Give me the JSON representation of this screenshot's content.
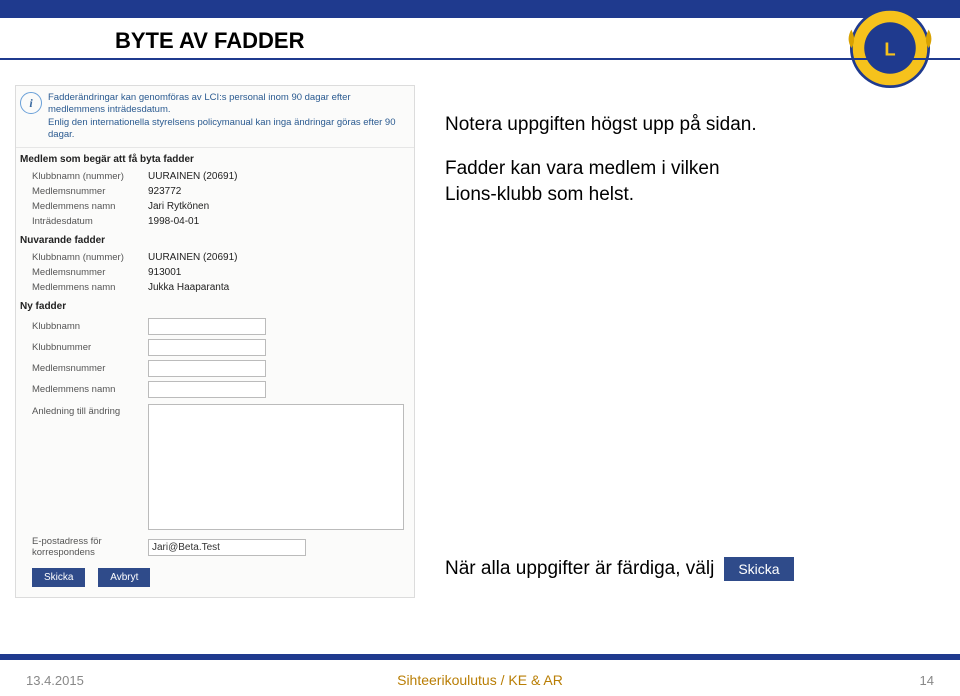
{
  "title": "BYTE AV FADDER",
  "info": {
    "line1": "Fadderändringar kan genomföras av LCI:s personal inom 90 dagar efter medlemmens inträdesdatum.",
    "line2": "Enlig den internationella styrelsens policymanual kan inga ändringar göras efter 90 dagar."
  },
  "sections": {
    "member": "Medlem som begär att få byta fadder",
    "current": "Nuvarande fadder",
    "new": "Ny fadder"
  },
  "labels": {
    "clubname": "Klubbnamn (nummer)",
    "clubname_short": "Klubbnamn",
    "clubnum": "Klubbnummer",
    "memnum": "Medlemsnummer",
    "memname": "Medlemmens namn",
    "joindate": "Inträdesdatum",
    "reason": "Anledning till ändring",
    "email": "E-postadress för korrespondens"
  },
  "member": {
    "club": "UURAINEN (20691)",
    "num": "923772",
    "name": "Jari Rytkönen",
    "date": "1998-04-01"
  },
  "current": {
    "club": "UURAINEN (20691)",
    "num": "913001",
    "name": "Jukka Haaparanta"
  },
  "new": {
    "club": "",
    "clubnum": "",
    "num": "",
    "name": ""
  },
  "email_value": "Jari@Beta.Test",
  "buttons": {
    "send": "Skicka",
    "cancel": "Avbryt"
  },
  "notes": {
    "n1": "Notera uppgiften högst upp på sidan.",
    "n2a": "Fadder kan vara medlem i vilken",
    "n2b": "Lions-klubb som helst.",
    "n3": "När alla uppgifter är färdiga, välj"
  },
  "inline_btn": "Skicka",
  "footer": {
    "date": "13.4.2015",
    "center": "Sihteerikoulutus / KE & AR",
    "page": "14"
  }
}
